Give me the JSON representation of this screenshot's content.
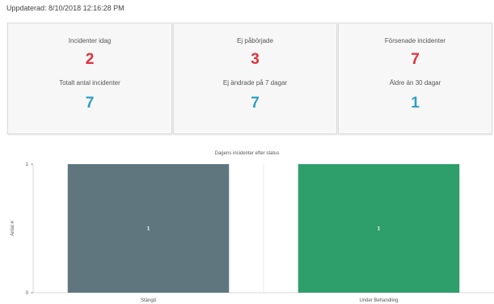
{
  "header": {
    "updated": "Uppdaterad: 8/10/2018 12:16:28 PM"
  },
  "cards": [
    {
      "top_label": "Incidenter idag",
      "top_value": "2",
      "bottom_label": "Totalt antal incidenter",
      "bottom_value": "7"
    },
    {
      "top_label": "Ej påbörjade",
      "top_value": "3",
      "bottom_label": "Ej ändrade på 7 dagar",
      "bottom_value": "7"
    },
    {
      "top_label": "Försenade incidenter",
      "top_value": "7",
      "bottom_label": "Äldre än 30 dagar",
      "bottom_value": "1"
    }
  ],
  "colors": {
    "red": "#e0303a",
    "blue": "#2f9fc4",
    "stangd": "#5f767f",
    "behandling": "#2e9e6b"
  },
  "chart_data": {
    "type": "bar",
    "title": "Dagens incidenter efter status",
    "xlabel": "",
    "ylabel": "Antal #",
    "categories": [
      "Stängd",
      "Under Behandling"
    ],
    "values": [
      1,
      1
    ],
    "data_labels": [
      "1",
      "1"
    ],
    "ylim": [
      0,
      1
    ],
    "yticks": [
      "0",
      "1"
    ],
    "bar_colors": [
      "#5f767f",
      "#2e9e6b"
    ]
  }
}
